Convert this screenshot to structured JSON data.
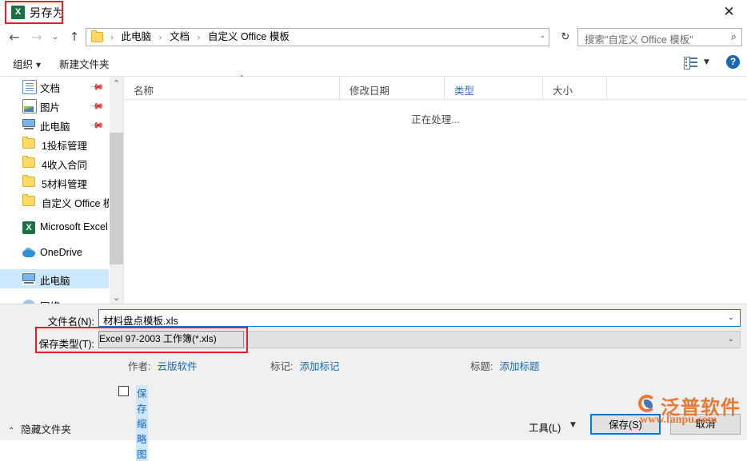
{
  "window": {
    "title": "另存为",
    "app_icon": "excel-icon",
    "close_label": "✕"
  },
  "navbar": {
    "back_icon": "←",
    "forward_icon": "→",
    "recent_icon": "⌄",
    "up_icon": "↑",
    "refresh_icon": "↻",
    "breadcrumbs": [
      "此电脑",
      "文档",
      "自定义 Office 模板"
    ],
    "separator": "›",
    "dropdown_icon": "⌄",
    "search_placeholder": "搜索\"自定义 Office 模板\"",
    "search_icon": "⌕"
  },
  "toolbar": {
    "organize_label": "组织",
    "organize_caret": "▼",
    "new_folder_label": "新建文件夹",
    "view_caret": "▼",
    "help_label": "?"
  },
  "sidebar": {
    "items": [
      {
        "label": "文档",
        "icon": "document-icon",
        "pinned": true,
        "selected": false,
        "indent": false
      },
      {
        "label": "图片",
        "icon": "pictures-icon",
        "pinned": true,
        "selected": false,
        "indent": false
      },
      {
        "label": "此电脑",
        "icon": "this-pc-icon",
        "pinned": true,
        "selected": false,
        "indent": false
      },
      {
        "label": "1投标管理",
        "icon": "folder-icon",
        "pinned": false,
        "selected": false,
        "indent": true
      },
      {
        "label": "4收入合同",
        "icon": "folder-icon",
        "pinned": false,
        "selected": false,
        "indent": true
      },
      {
        "label": "5材料管理",
        "icon": "folder-icon",
        "pinned": false,
        "selected": false,
        "indent": true
      },
      {
        "label": "自定义 Office 模",
        "icon": "folder-icon",
        "pinned": false,
        "selected": false,
        "indent": true
      },
      {
        "label": "Microsoft Excel",
        "icon": "excel-icon",
        "pinned": false,
        "selected": false,
        "indent": false
      },
      {
        "label": "OneDrive",
        "icon": "onedrive-icon",
        "pinned": false,
        "selected": false,
        "indent": false
      },
      {
        "label": "此电脑",
        "icon": "this-pc-icon",
        "pinned": false,
        "selected": true,
        "indent": false
      },
      {
        "label": "网络",
        "icon": "network-icon",
        "pinned": false,
        "selected": false,
        "indent": false
      }
    ],
    "scroll_up_icon": "⌃",
    "scroll_down_icon": "⌄"
  },
  "filelist": {
    "columns": [
      {
        "label": "名称",
        "active": false
      },
      {
        "label": "修改日期",
        "active": false
      },
      {
        "label": "类型",
        "active": true
      },
      {
        "label": "大小",
        "active": false
      }
    ],
    "sort_caret": "⌃",
    "status": "正在处理..."
  },
  "form": {
    "filename_label": "文件名(N):",
    "filename_value": "材料盘点模板.xls",
    "savetype_label": "保存类型(T):",
    "savetype_value": "Excel 97-2003 工作簿(*.xls)",
    "combo_caret": "⌄",
    "author_label": "作者:",
    "author_value": "云版软件",
    "tags_label": "标记:",
    "tags_value": "添加标记",
    "title_label": "标题:",
    "title_value": "添加标题",
    "thumbnail_label": "保存缩略图"
  },
  "footer": {
    "hide_folders_label": "隐藏文件夹",
    "hide_folders_caret": "⌃",
    "tools_label": "工具(L)",
    "tools_caret": "▼",
    "save_label": "保存(S)",
    "cancel_label": "取消"
  },
  "watermark": {
    "brand_cn": "泛普软件",
    "brand_url": "www.fanpu.com"
  },
  "colors": {
    "accent": "#0078d7",
    "highlight_red": "#ee1b22",
    "link_blue": "#1768b5",
    "selection_blue": "#cce8ff",
    "watermark_orange": "#e8732a"
  }
}
